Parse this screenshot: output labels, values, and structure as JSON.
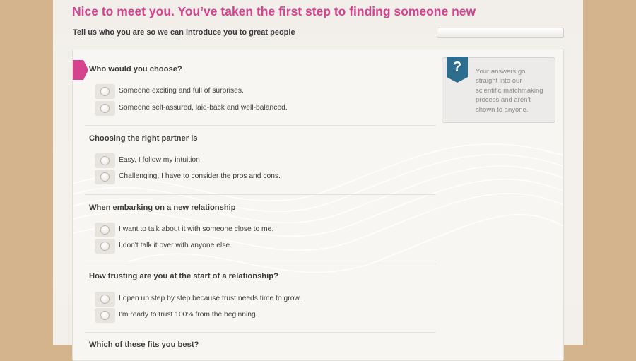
{
  "header": {
    "title": "Nice to meet you. You’ve taken the first step to finding someone new",
    "subtitle": "Tell us who you are so we can introduce you to great people"
  },
  "info_box": {
    "icon": "question-mark-icon",
    "badge_char": "?",
    "text": "Your answers go straight into our scientific matchmaking process and aren't shown to anyone."
  },
  "questions": [
    {
      "text": "Who would you choose?",
      "options": [
        "Someone exciting and full of surprises.",
        "Someone self-assured, laid-back and well-balanced."
      ]
    },
    {
      "text": "Choosing the right partner is",
      "options": [
        "Easy, I follow my intuition",
        "Challenging, I have to consider the pros and cons."
      ]
    },
    {
      "text": "When embarking on a new relationship",
      "options": [
        "I want to talk about it with someone close to me.",
        "I don't talk it over with anyone else."
      ]
    },
    {
      "text": "How trusting are you at the start of a relationship?",
      "options": [
        "I open up step by step because trust needs time to grow.",
        "I'm ready to trust 100% from the beginning."
      ]
    },
    {
      "text": "Which of these fits you best?",
      "options": []
    }
  ],
  "colors": {
    "accent": "#d5428e",
    "info_badge": "#2d6d8e",
    "background": "#d4b48c"
  }
}
